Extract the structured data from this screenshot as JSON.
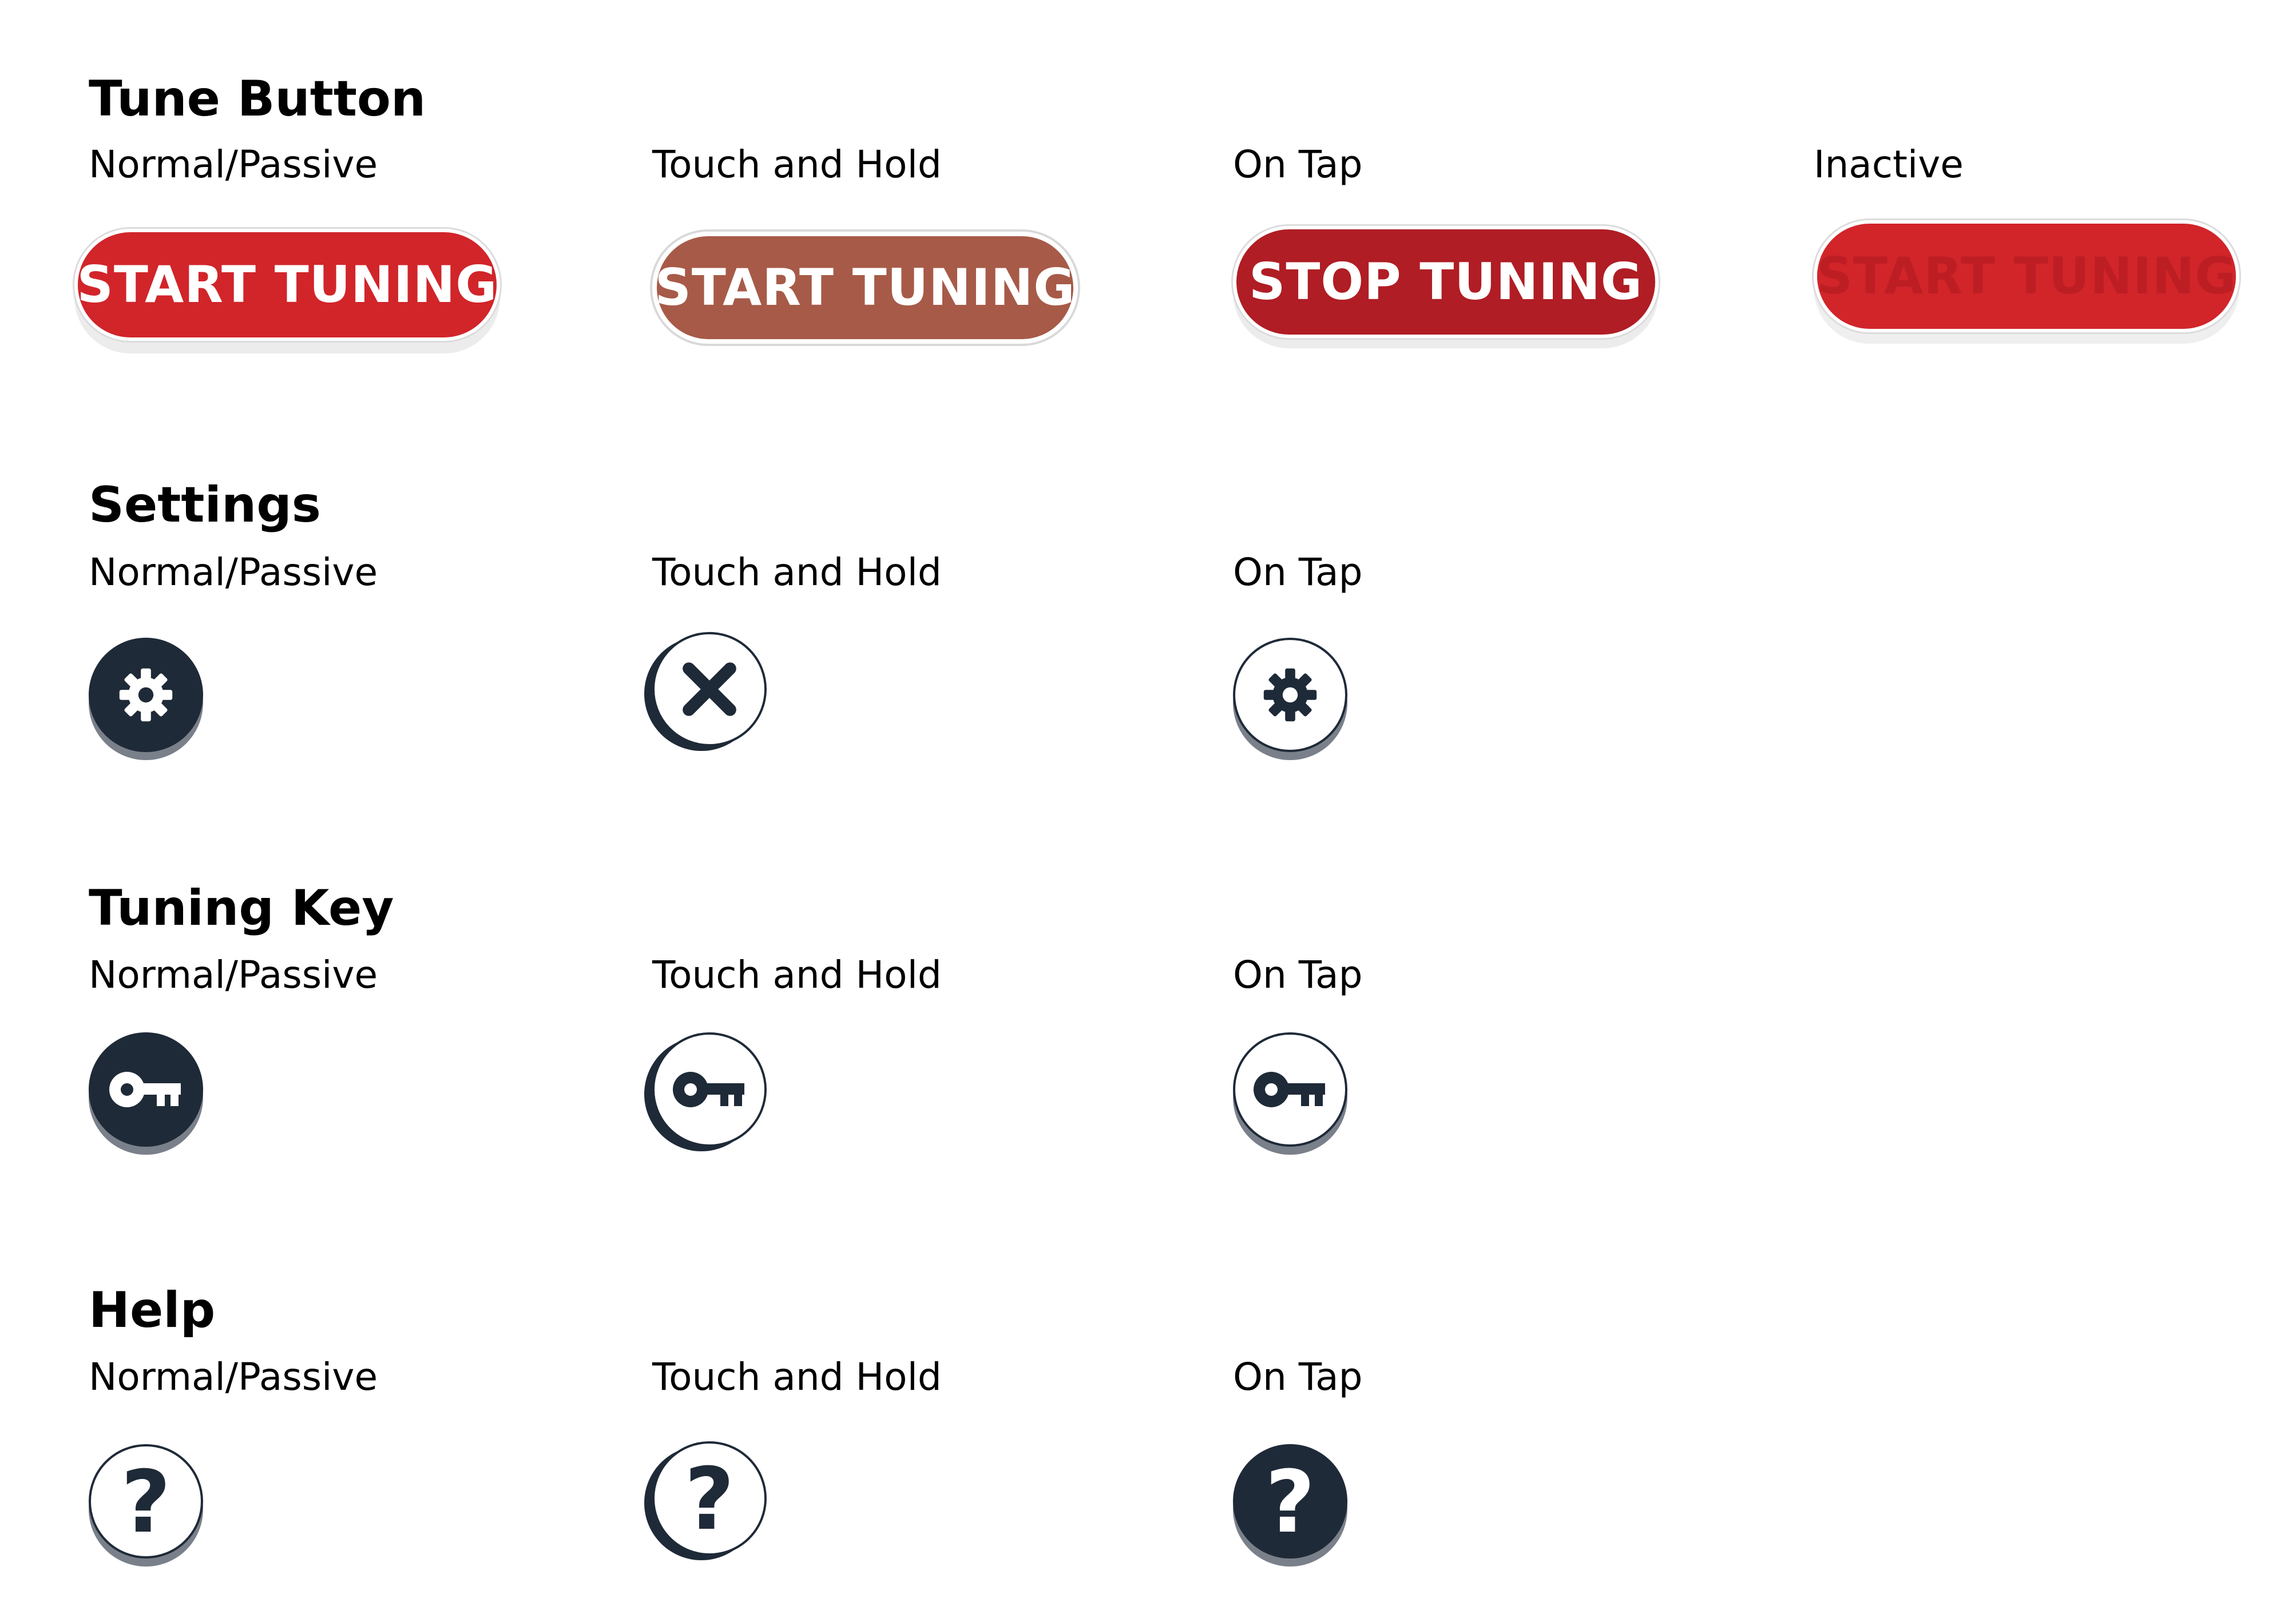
{
  "colors": {
    "brand_red": "#d1252a",
    "hold_brown": "#a75a48",
    "tap_red": "#b01d24",
    "inactive_text": "#bd1e24",
    "navy": "#1f2a38",
    "shadow_gray": "#7a808a"
  },
  "tune_button": {
    "title": "Tune Button",
    "states": [
      {
        "label": "Normal/Passive",
        "button_text": "START TUNING"
      },
      {
        "label": "Touch and Hold",
        "button_text": "START TUNING"
      },
      {
        "label": "On Tap",
        "button_text": "STOP TUNING"
      },
      {
        "label": "Inactive",
        "button_text": "START TUNING"
      }
    ]
  },
  "settings": {
    "title": "Settings",
    "states": [
      {
        "label": "Normal/Passive",
        "icon": "gear-icon"
      },
      {
        "label": "Touch and Hold",
        "icon": "close-icon"
      },
      {
        "label": "On Tap",
        "icon": "gear-icon"
      }
    ]
  },
  "tuning_key": {
    "title": "Tuning Key",
    "states": [
      {
        "label": "Normal/Passive",
        "icon": "key-icon"
      },
      {
        "label": "Touch and Hold",
        "icon": "key-icon"
      },
      {
        "label": "On Tap",
        "icon": "key-icon"
      }
    ]
  },
  "help": {
    "title": "Help",
    "states": [
      {
        "label": "Normal/Passive",
        "icon": "question-mark-icon",
        "glyph": "?"
      },
      {
        "label": "Touch and Hold",
        "icon": "question-mark-icon",
        "glyph": "?"
      },
      {
        "label": "On Tap",
        "icon": "question-mark-icon",
        "glyph": "?"
      }
    ]
  }
}
